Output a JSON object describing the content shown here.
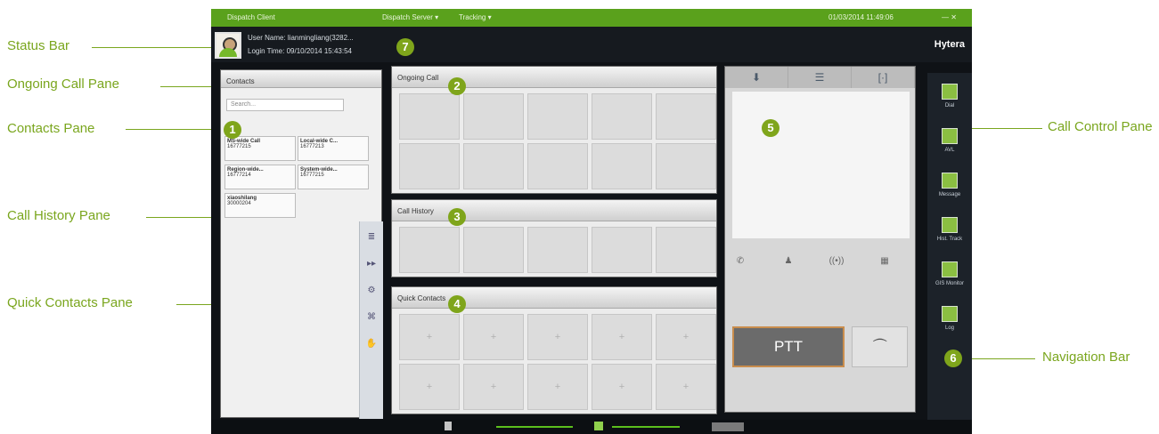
{
  "callouts": {
    "status_bar": "Status Bar",
    "ongoing_call_pane": "Ongoing Call Pane",
    "contacts_pane": "Contacts Pane",
    "call_history_pane": "Call History Pane",
    "quick_contacts_pane": "Quick Contacts Pane",
    "call_control_pane": "Call Control Pane",
    "navigation_bar": "Navigation Bar"
  },
  "badges": [
    "1",
    "2",
    "3",
    "4",
    "5",
    "6",
    "7"
  ],
  "app": {
    "title": "Dispatch Client",
    "server": "Dispatch Server ▾",
    "tracking": "Tracking ▾",
    "datetime": "01/03/2014 11:49:06",
    "window_controls": "—  ✕",
    "user_name": "User Name: lianmingliang(3282...",
    "login_time": "Login Time: 09/10/2014 15:43:54",
    "brand": "Hytera"
  },
  "contacts": {
    "title": "Contacts",
    "search_placeholder": "Search...",
    "cards": [
      {
        "name": "MS-wide Call",
        "id": "16777215"
      },
      {
        "name": "Local-wide C...",
        "id": "16777213"
      },
      {
        "name": "Region-wide...",
        "id": "16777214"
      },
      {
        "name": "System-wide...",
        "id": "16777215"
      },
      {
        "name": "xiaoshilang",
        "id": "30000204"
      }
    ],
    "side_tools": [
      "≣",
      "▸▸",
      "⚙",
      "⌘",
      "✋"
    ]
  },
  "ongoing_call": {
    "title": "Ongoing Call"
  },
  "call_history": {
    "title": "Call History"
  },
  "quick_contacts": {
    "title": "Quick Contacts",
    "plus_symbol": "+"
  },
  "control": {
    "tabs": [
      "⬇",
      "☰",
      "[·]"
    ],
    "ptt": "PTT",
    "end_call": "⏜",
    "icons": [
      "✆",
      "♟",
      "((•))",
      "▦"
    ]
  },
  "nav": {
    "items": [
      "Dial",
      "AVL",
      "Message",
      "Hist. Track",
      "GIS Monitor",
      "Log"
    ]
  }
}
